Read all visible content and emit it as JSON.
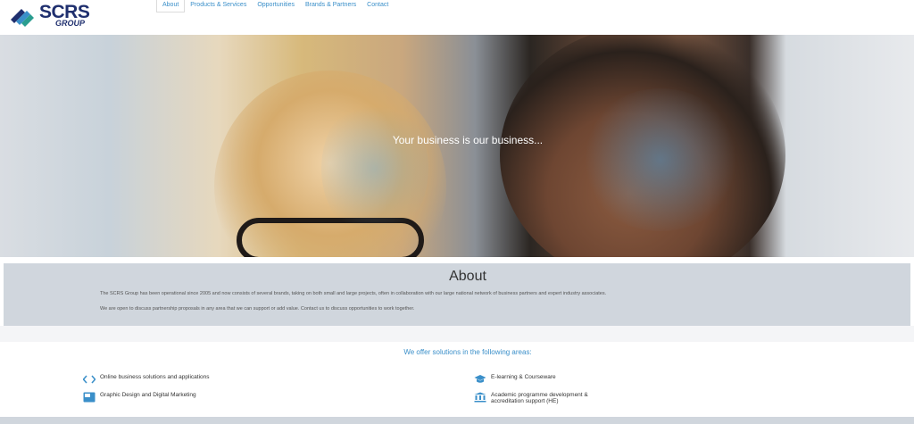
{
  "brand": {
    "name": "SCRS",
    "sub": "GROUP"
  },
  "nav": {
    "items": [
      {
        "label": "About",
        "active": true
      },
      {
        "label": "Products & Services",
        "active": false
      },
      {
        "label": "Opportunities",
        "active": false
      },
      {
        "label": "Brands & Partners",
        "active": false
      },
      {
        "label": "Contact",
        "active": false
      }
    ]
  },
  "hero": {
    "title": "Your business is our business..."
  },
  "about": {
    "title": "About",
    "p1": "The SCRS Group has been operational since 2005 and now consists of several brands, taking on both small and large projects, often in collaboration with our large national network of business partners and expert industry associates.",
    "p2": "We are open to discuss partnership proposals in any area that we can support or add value. Contact us to discuss opportunities to work together."
  },
  "offer": {
    "title": "We offer solutions in the following areas:",
    "services": [
      {
        "label": "Online business solutions and applications",
        "icon": "code-icon"
      },
      {
        "label": "Graphic Design and Digital Marketing",
        "icon": "monitor-icon"
      },
      {
        "label": "E-learning & Courseware",
        "icon": "graduation-cap-icon"
      },
      {
        "label": "Academic programme development &",
        "label2": "accreditation support (HE)",
        "icon": "institution-icon"
      }
    ]
  },
  "colors": {
    "accent": "#3a8fc9",
    "brand": "#1f2f6e",
    "panel": "#d0d6dd"
  }
}
